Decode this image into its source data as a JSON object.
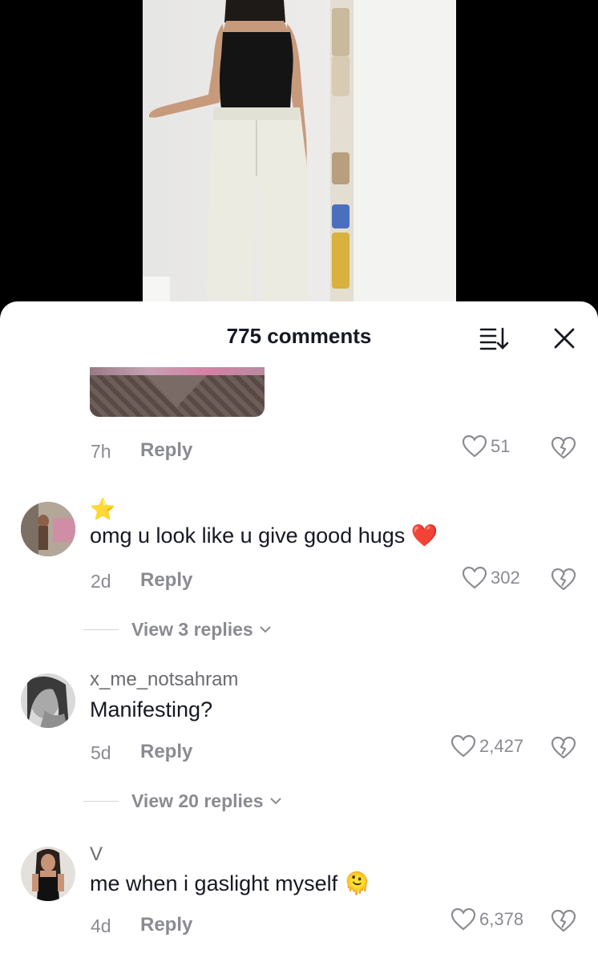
{
  "sheet": {
    "title": "775 comments"
  },
  "top_comment": {
    "time": "7h",
    "reply": "Reply",
    "likes": "51"
  },
  "comments": [
    {
      "username": "",
      "badge": "⭐",
      "text": "omg u look like u give good hugs",
      "emoji": "❤️",
      "time": "2d",
      "reply": "Reply",
      "likes": "302",
      "view_replies": "View 3 replies"
    },
    {
      "username": "x_me_notsahram",
      "text": "Manifesting?",
      "time": "5d",
      "reply": "Reply",
      "likes": "2,427",
      "view_replies": "View 20 replies"
    },
    {
      "username": "V",
      "text": "me when i gaslight myself",
      "emoji": "🫠",
      "time": "4d",
      "reply": "Reply",
      "likes": "6,378"
    }
  ],
  "icons": {
    "sort": "sort-icon",
    "close": "close-icon",
    "like": "heart-icon",
    "dislike": "broken-heart-icon",
    "chevron": "chevron-down-icon"
  },
  "colors": {
    "text": "#161823",
    "muted": "#8a8b91",
    "heart": "#e8212b",
    "sheet": "#ffffff",
    "backdrop": "#000000"
  }
}
